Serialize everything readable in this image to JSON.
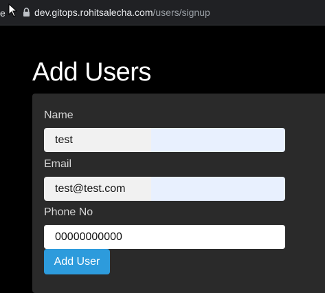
{
  "browser": {
    "url_host": "dev.gitops.rohitsalecha.com",
    "url_path": "/users/signup",
    "edge_glyph": "e"
  },
  "page": {
    "title": "Add Users"
  },
  "form": {
    "name_label": "Name",
    "name_value": "test",
    "email_label": "Email",
    "email_value": "test@test.com",
    "phone_label": "Phone No",
    "phone_value": "00000000000",
    "submit_label": "Add User"
  },
  "colors": {
    "page_background": "#000000",
    "card_background": "#2a2a2a",
    "autofill_background": "#e8f0fe",
    "button_primary": "#2d9bdc"
  },
  "icons": {
    "address_bar": "lock-icon",
    "pointer": "mouse-cursor-icon"
  }
}
